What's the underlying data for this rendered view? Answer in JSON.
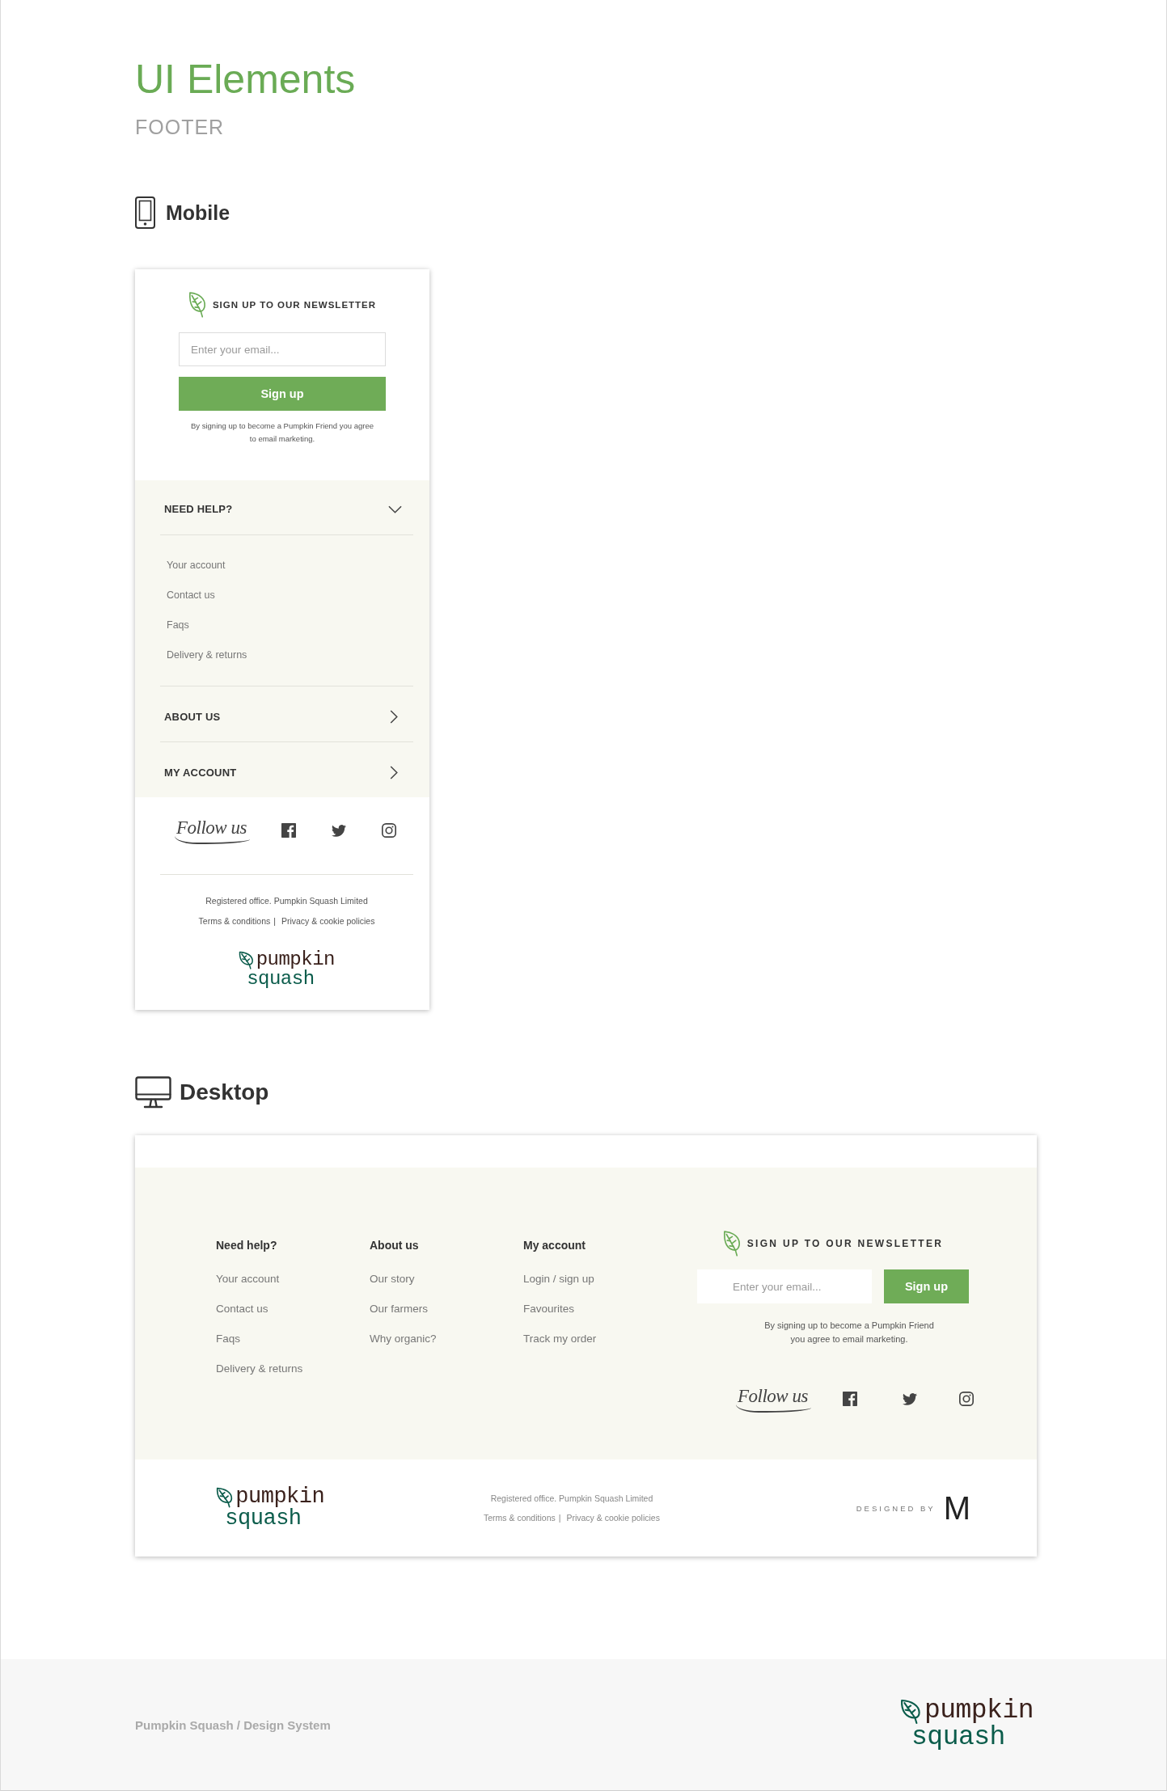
{
  "header": {
    "title": "UI Elements",
    "subtitle": "FOOTER"
  },
  "mobile": {
    "label": "Mobile",
    "newsletter": {
      "heading": "SIGN UP TO OUR NEWSLETTER",
      "email_field": {
        "placeholder": "Enter your email..."
      },
      "button": "Sign up",
      "disclaimer": "By signing up to become a Pumpkin Friend you agree to email marketing."
    },
    "accordion": [
      {
        "title": "NEED HELP?",
        "expanded": true,
        "links": [
          "Your account",
          "Contact us",
          "Faqs",
          "Delivery & returns"
        ]
      },
      {
        "title": "ABOUT US",
        "expanded": false
      },
      {
        "title": "MY ACCOUNT",
        "expanded": false
      }
    ],
    "social": {
      "label": "Follow us"
    },
    "legal": {
      "office": "Registered office. Pumpkin Squash Limited",
      "links": [
        "Terms & conditions",
        "Privacy & cookie policies"
      ],
      "separator": "|"
    },
    "logo": {
      "line_1": "pumpkin",
      "line_2": "squash"
    }
  },
  "desktop": {
    "label": "Desktop",
    "columns": [
      {
        "heading": "Need help?",
        "links": [
          "Your account",
          "Contact us",
          "Faqs",
          "Delivery & returns"
        ]
      },
      {
        "heading": "About us",
        "links": [
          "Our story",
          "Our farmers",
          "Why organic?"
        ]
      },
      {
        "heading": "My account",
        "links": [
          "Login / sign up",
          "Favourites",
          "Track my order"
        ]
      }
    ],
    "newsletter": {
      "heading": "SIGN UP TO OUR NEWSLETTER",
      "email_field": {
        "placeholder": "Enter your email..."
      },
      "button": "Sign up",
      "disclaimer": "By signing up to become a Pumpkin Friend you agree to email marketing."
    },
    "social": {
      "label": "Follow us"
    },
    "logo": {
      "line_1": "pumpkin",
      "line_2": "squash"
    },
    "legal": {
      "office": "Registered office. Pumpkin Squash Limited",
      "links": [
        "Terms & conditions",
        "Privacy & cookie policies"
      ],
      "separator": "|"
    },
    "credit": {
      "label": "DESIGNED BY",
      "mark": "M"
    }
  },
  "page_footer": {
    "caption": "Pumpkin Squash / Design System",
    "logo": {
      "line_1": "pumpkin",
      "line_2": "squash"
    }
  }
}
